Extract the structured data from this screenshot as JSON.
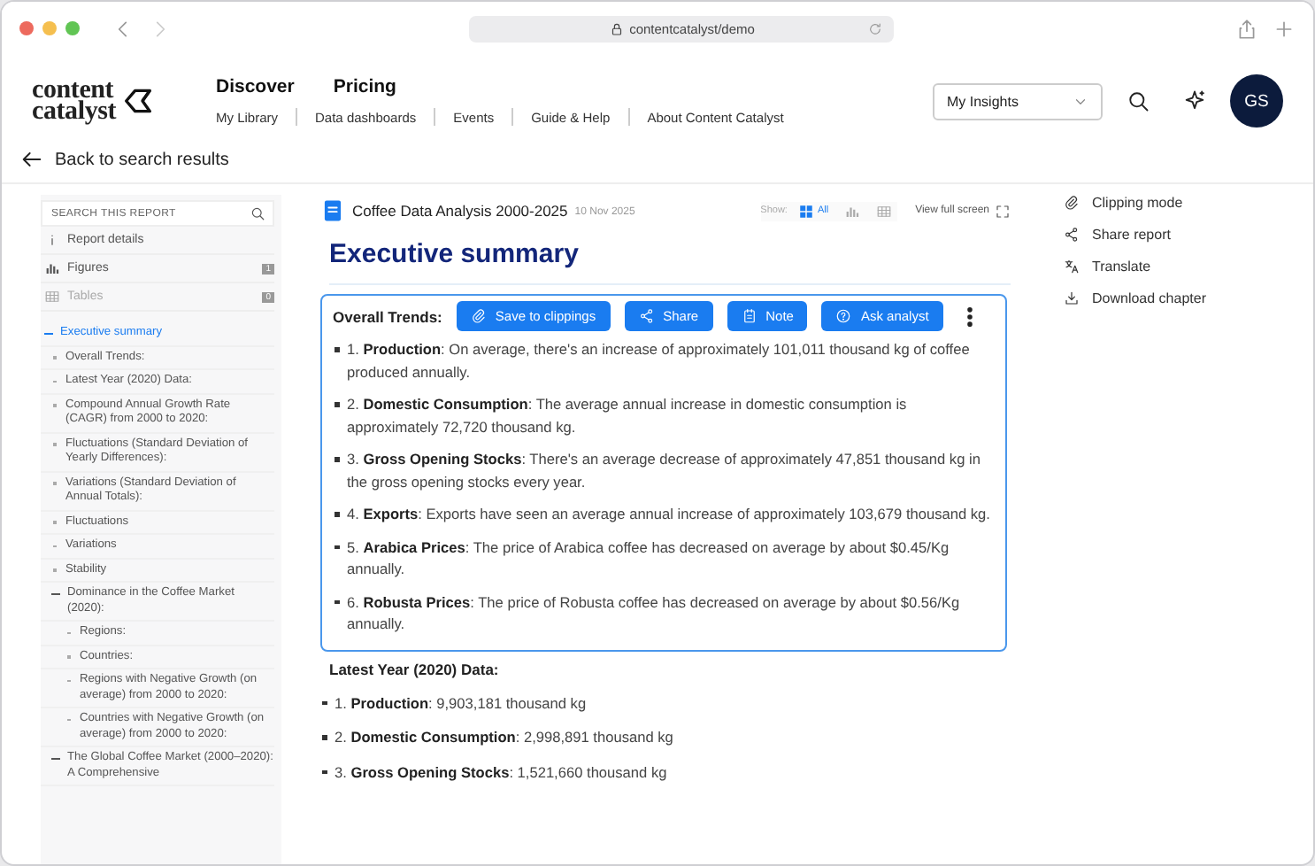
{
  "browser": {
    "url": "contentcatalyst/demo"
  },
  "header": {
    "logo": [
      "content",
      "catalyst"
    ],
    "nav_main": [
      "Discover",
      "Pricing"
    ],
    "nav_sub": [
      "My Library",
      "Data dashboards",
      "Events",
      "Guide & Help",
      "About Content Catalyst"
    ],
    "insights_select": "My Insights",
    "avatar": "GS"
  },
  "back_link": "Back to search results",
  "sidebar": {
    "search_placeholder": "SEARCH THIS REPORT",
    "items": [
      {
        "kind": "info",
        "label": "Report details",
        "disabled": false
      },
      {
        "kind": "figures",
        "label": "Figures",
        "count": "1",
        "disabled": false
      },
      {
        "kind": "tables",
        "label": "Tables",
        "count": "0",
        "disabled": true
      }
    ],
    "toc": [
      {
        "label": "Executive summary",
        "selected": true,
        "expanded": true,
        "children": [
          {
            "label": "Overall Trends:",
            "selected": false
          },
          {
            "label": "Latest Year (2020) Data:",
            "selected": false
          },
          {
            "label": "Compound Annual Growth Rate (CAGR) from 2000 to 2020:",
            "selected": false
          },
          {
            "label": "Fluctuations (Standard Deviation of Yearly Differences):",
            "selected": false
          },
          {
            "label": "Variations (Standard Deviation of Annual Totals):",
            "selected": false
          },
          {
            "label": "Fluctuations",
            "selected": false
          },
          {
            "label": "Variations",
            "selected": false
          },
          {
            "label": "Stability",
            "selected": false
          },
          {
            "label": "Dominance in the Coffee Market (2020):",
            "selected": false,
            "expanded": true,
            "children": [
              {
                "label": "Regions:",
                "selected": false
              },
              {
                "label": "Countries:",
                "selected": false
              },
              {
                "label": "Regions with Negative Growth (on average) from 2000 to 2020:",
                "selected": false
              },
              {
                "label": "Countries with Negative Growth (on average) from 2000 to 2020:",
                "selected": false
              }
            ]
          },
          {
            "label": "The Global Coffee Market (2000–2020): A Comprehensive",
            "selected": false,
            "expanded": true
          }
        ]
      }
    ]
  },
  "document": {
    "title": "Coffee Data Analysis 2000-2025",
    "date": "10 Nov 2025",
    "show_label": "Show:",
    "filters": [
      {
        "kind": "all",
        "label": "All",
        "selected": true
      },
      {
        "kind": "figures",
        "selected": false
      },
      {
        "kind": "tables",
        "selected": false
      }
    ],
    "full_screen": "View full screen",
    "heading": "Executive summary",
    "highlighted": {
      "title": "Overall Trends:",
      "actions": [
        {
          "kind": "clip",
          "label": "Save to clippings"
        },
        {
          "kind": "share",
          "label": "Share"
        },
        {
          "kind": "note",
          "label": "Note"
        },
        {
          "kind": "ask",
          "label": "Ask analyst"
        }
      ],
      "bullets": [
        "1. **Production**: On average, there's an increase of approximately 101,011 thousand kg of coffee produced annually.",
        "2. **Domestic Consumption**: The average annual increase in domestic consumption is approximately 72,720 thousand kg.",
        "3. **Gross Opening Stocks**: There's an average decrease of approximately 47,851 thousand kg in the gross opening stocks every year.",
        "4. **Exports**: Exports have seen an average annual increase of approximately 103,679 thousand kg.",
        "5. **Arabica Prices**: The price of Arabica coffee has decreased on average by about $0.45/Kg annually.",
        "6. **Robusta Prices**: The price of Robusta coffee has decreased on average by about $0.56/Kg annually."
      ]
    },
    "section": {
      "title": "Latest Year (2020) Data:",
      "bullets": [
        "1. **Production**: 9,903,181 thousand kg",
        "2. **Domestic Consumption**: 2,998,891 thousand kg",
        "3. **Gross Opening Stocks**: 1,521,660 thousand kg"
      ]
    }
  },
  "tools": [
    {
      "kind": "clip",
      "label": "Clipping mode"
    },
    {
      "kind": "share",
      "label": "Share report"
    },
    {
      "kind": "translate",
      "label": "Translate"
    },
    {
      "kind": "download",
      "label": "Download chapter"
    }
  ]
}
